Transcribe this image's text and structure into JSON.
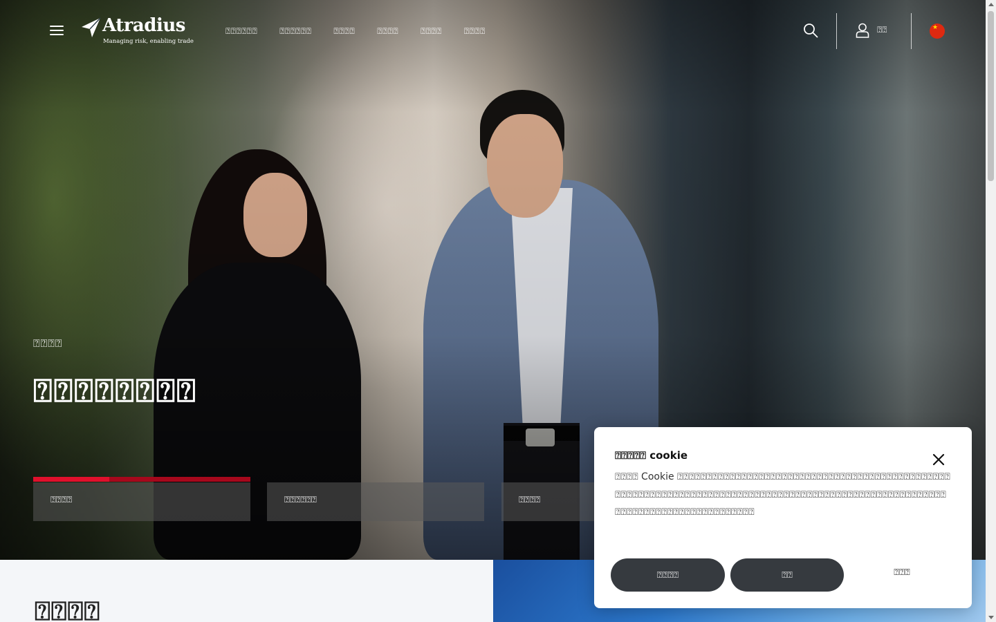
{
  "header": {
    "logo": {
      "name": "Atradius",
      "tagline": "Managing risk, enabling trade"
    },
    "nav": [
      "⍰⍰⍰⍰⍰⍰",
      "⍰⍰⍰⍰⍰⍰",
      "⍰⍰⍰⍰",
      "⍰⍰⍰⍰",
      "⍰⍰⍰⍰",
      "⍰⍰⍰⍰"
    ],
    "login_label": "⍰⍰",
    "icons": {
      "menu": "hamburger-icon",
      "search": "search-icon",
      "user": "user-icon",
      "language": "china-flag-icon"
    }
  },
  "hero": {
    "eyebrow": "⍰⍰⍰⍰",
    "title": "⍰⍰⍰⍰⍰⍰⍰⍰",
    "tabs": [
      {
        "label": "⍰⍰⍰⍰",
        "active": true,
        "progress": 0.35
      },
      {
        "label": "⍰⍰⍰⍰⍰⍰",
        "active": false
      },
      {
        "label": "⍰⍰⍰⍰",
        "active": false
      }
    ]
  },
  "section": {
    "title": "⍰⍰⍰⍰"
  },
  "cookie": {
    "title": "⍰⍰⍰⍰⍰ cookie",
    "body": "⍰⍰⍰⍰ Cookie ⍰⍰⍰⍰⍰⍰⍰⍰⍰⍰⍰⍰⍰⍰⍰⍰⍰⍰⍰⍰⍰⍰⍰⍰⍰⍰⍰⍰⍰⍰⍰⍰⍰⍰⍰⍰⍰⍰⍰⍰⍰⍰⍰⍰⍰⍰⍰⍰⍰⍰⍰⍰⍰⍰⍰⍰⍰⍰⍰⍰⍰⍰⍰⍰⍰⍰⍰⍰⍰⍰⍰⍰⍰⍰⍰⍰⍰⍰⍰⍰⍰⍰⍰⍰⍰⍰⍰⍰⍰⍰⍰⍰⍰⍰⍰⍰⍰⍰⍰⍰⍰⍰⍰⍰⍰⍰⍰⍰⍰⍰⍰⍰⍰⍰⍰⍰⍰⍰⍰⍰⍰⍰⍰⍰⍰⍰⍰⍰",
    "buttons": {
      "accept": "⍰⍰⍰⍰",
      "settings": "⍰⍰",
      "reject": "⍰⍰⍰"
    }
  },
  "colors": {
    "accent_red": "#e0102c",
    "button_dark": "#363a3f"
  }
}
